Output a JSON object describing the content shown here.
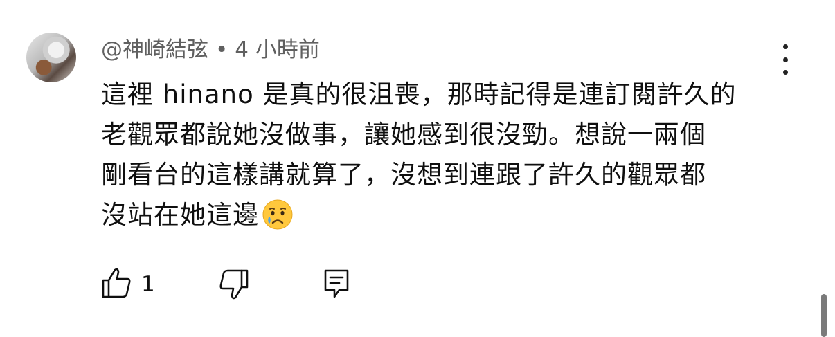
{
  "comment": {
    "author": "@神崎結弦",
    "separator": "•",
    "time": "4 小時前",
    "lines": [
      "這裡 hinano 是真的很沮喪，那時記得是連訂閱許久的",
      "老觀眾都說她沒做事，讓她感到很沒勁。想說一兩個",
      "剛看台的這樣講就算了，沒想到連跟了許久的觀眾都",
      "沒站在她這邊"
    ],
    "emoji": "crying-face-icon"
  },
  "actions": {
    "like_count": "1",
    "icons": [
      "thumbs-up-icon",
      "thumbs-down-icon",
      "reply-icon"
    ]
  },
  "colors": {
    "text": "#0f0f0f",
    "meta": "#606060",
    "background": "#ffffff"
  }
}
